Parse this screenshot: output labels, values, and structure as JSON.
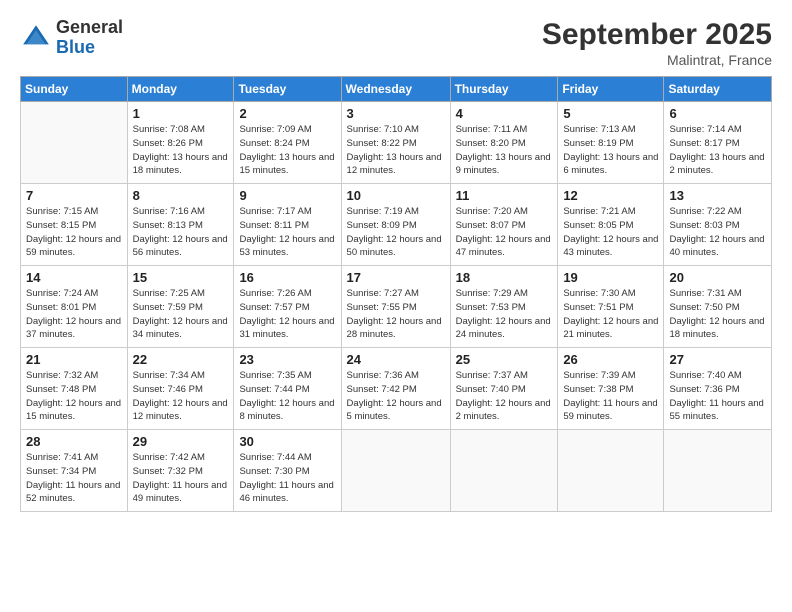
{
  "logo": {
    "general": "General",
    "blue": "Blue"
  },
  "title": {
    "month": "September 2025",
    "location": "Malintrat, France"
  },
  "header_days": [
    "Sunday",
    "Monday",
    "Tuesday",
    "Wednesday",
    "Thursday",
    "Friday",
    "Saturday"
  ],
  "weeks": [
    [
      {
        "day": "",
        "info": ""
      },
      {
        "day": "1",
        "info": "Sunrise: 7:08 AM\nSunset: 8:26 PM\nDaylight: 13 hours\nand 18 minutes."
      },
      {
        "day": "2",
        "info": "Sunrise: 7:09 AM\nSunset: 8:24 PM\nDaylight: 13 hours\nand 15 minutes."
      },
      {
        "day": "3",
        "info": "Sunrise: 7:10 AM\nSunset: 8:22 PM\nDaylight: 13 hours\nand 12 minutes."
      },
      {
        "day": "4",
        "info": "Sunrise: 7:11 AM\nSunset: 8:20 PM\nDaylight: 13 hours\nand 9 minutes."
      },
      {
        "day": "5",
        "info": "Sunrise: 7:13 AM\nSunset: 8:19 PM\nDaylight: 13 hours\nand 6 minutes."
      },
      {
        "day": "6",
        "info": "Sunrise: 7:14 AM\nSunset: 8:17 PM\nDaylight: 13 hours\nand 2 minutes."
      }
    ],
    [
      {
        "day": "7",
        "info": "Sunrise: 7:15 AM\nSunset: 8:15 PM\nDaylight: 12 hours\nand 59 minutes."
      },
      {
        "day": "8",
        "info": "Sunrise: 7:16 AM\nSunset: 8:13 PM\nDaylight: 12 hours\nand 56 minutes."
      },
      {
        "day": "9",
        "info": "Sunrise: 7:17 AM\nSunset: 8:11 PM\nDaylight: 12 hours\nand 53 minutes."
      },
      {
        "day": "10",
        "info": "Sunrise: 7:19 AM\nSunset: 8:09 PM\nDaylight: 12 hours\nand 50 minutes."
      },
      {
        "day": "11",
        "info": "Sunrise: 7:20 AM\nSunset: 8:07 PM\nDaylight: 12 hours\nand 47 minutes."
      },
      {
        "day": "12",
        "info": "Sunrise: 7:21 AM\nSunset: 8:05 PM\nDaylight: 12 hours\nand 43 minutes."
      },
      {
        "day": "13",
        "info": "Sunrise: 7:22 AM\nSunset: 8:03 PM\nDaylight: 12 hours\nand 40 minutes."
      }
    ],
    [
      {
        "day": "14",
        "info": "Sunrise: 7:24 AM\nSunset: 8:01 PM\nDaylight: 12 hours\nand 37 minutes."
      },
      {
        "day": "15",
        "info": "Sunrise: 7:25 AM\nSunset: 7:59 PM\nDaylight: 12 hours\nand 34 minutes."
      },
      {
        "day": "16",
        "info": "Sunrise: 7:26 AM\nSunset: 7:57 PM\nDaylight: 12 hours\nand 31 minutes."
      },
      {
        "day": "17",
        "info": "Sunrise: 7:27 AM\nSunset: 7:55 PM\nDaylight: 12 hours\nand 28 minutes."
      },
      {
        "day": "18",
        "info": "Sunrise: 7:29 AM\nSunset: 7:53 PM\nDaylight: 12 hours\nand 24 minutes."
      },
      {
        "day": "19",
        "info": "Sunrise: 7:30 AM\nSunset: 7:51 PM\nDaylight: 12 hours\nand 21 minutes."
      },
      {
        "day": "20",
        "info": "Sunrise: 7:31 AM\nSunset: 7:50 PM\nDaylight: 12 hours\nand 18 minutes."
      }
    ],
    [
      {
        "day": "21",
        "info": "Sunrise: 7:32 AM\nSunset: 7:48 PM\nDaylight: 12 hours\nand 15 minutes."
      },
      {
        "day": "22",
        "info": "Sunrise: 7:34 AM\nSunset: 7:46 PM\nDaylight: 12 hours\nand 12 minutes."
      },
      {
        "day": "23",
        "info": "Sunrise: 7:35 AM\nSunset: 7:44 PM\nDaylight: 12 hours\nand 8 minutes."
      },
      {
        "day": "24",
        "info": "Sunrise: 7:36 AM\nSunset: 7:42 PM\nDaylight: 12 hours\nand 5 minutes."
      },
      {
        "day": "25",
        "info": "Sunrise: 7:37 AM\nSunset: 7:40 PM\nDaylight: 12 hours\nand 2 minutes."
      },
      {
        "day": "26",
        "info": "Sunrise: 7:39 AM\nSunset: 7:38 PM\nDaylight: 11 hours\nand 59 minutes."
      },
      {
        "day": "27",
        "info": "Sunrise: 7:40 AM\nSunset: 7:36 PM\nDaylight: 11 hours\nand 55 minutes."
      }
    ],
    [
      {
        "day": "28",
        "info": "Sunrise: 7:41 AM\nSunset: 7:34 PM\nDaylight: 11 hours\nand 52 minutes."
      },
      {
        "day": "29",
        "info": "Sunrise: 7:42 AM\nSunset: 7:32 PM\nDaylight: 11 hours\nand 49 minutes."
      },
      {
        "day": "30",
        "info": "Sunrise: 7:44 AM\nSunset: 7:30 PM\nDaylight: 11 hours\nand 46 minutes."
      },
      {
        "day": "",
        "info": ""
      },
      {
        "day": "",
        "info": ""
      },
      {
        "day": "",
        "info": ""
      },
      {
        "day": "",
        "info": ""
      }
    ]
  ]
}
